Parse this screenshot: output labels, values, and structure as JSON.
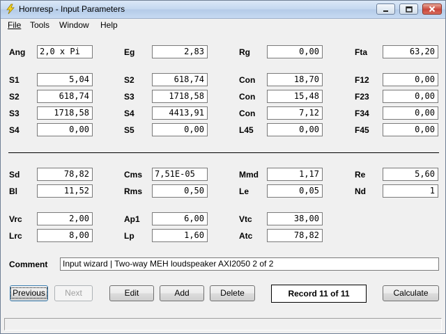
{
  "window": {
    "title": "Hornresp - Input Parameters"
  },
  "menu": {
    "file": "File",
    "tools": "Tools",
    "window": "Window",
    "help": "Help"
  },
  "params": {
    "ang": {
      "label": "Ang",
      "value": "2,0 x Pi"
    },
    "eg": {
      "label": "Eg",
      "value": "2,83"
    },
    "rg": {
      "label": "Rg",
      "value": "0,00"
    },
    "fta": {
      "label": "Fta",
      "value": "63,20"
    },
    "s1": {
      "label": "S1",
      "value": "5,04"
    },
    "s2a": {
      "label": "S2",
      "value": "618,74"
    },
    "con1": {
      "label": "Con",
      "value": "18,70"
    },
    "f12": {
      "label": "F12",
      "value": "0,00"
    },
    "s2b": {
      "label": "S2",
      "value": "618,74"
    },
    "s3a": {
      "label": "S3",
      "value": "1718,58"
    },
    "con2": {
      "label": "Con",
      "value": "15,48"
    },
    "f23": {
      "label": "F23",
      "value": "0,00"
    },
    "s3b": {
      "label": "S3",
      "value": "1718,58"
    },
    "s4a": {
      "label": "S4",
      "value": "4413,91"
    },
    "con3": {
      "label": "Con",
      "value": "7,12"
    },
    "f34": {
      "label": "F34",
      "value": "0,00"
    },
    "s4b": {
      "label": "S4",
      "value": "0,00"
    },
    "s5": {
      "label": "S5",
      "value": "0,00"
    },
    "l45": {
      "label": "L45",
      "value": "0,00"
    },
    "f45": {
      "label": "F45",
      "value": "0,00"
    },
    "sd": {
      "label": "Sd",
      "value": "78,82"
    },
    "cms": {
      "label": "Cms",
      "value": "7,51E-05"
    },
    "mmd": {
      "label": "Mmd",
      "value": "1,17"
    },
    "re": {
      "label": "Re",
      "value": "5,60"
    },
    "bl": {
      "label": "Bl",
      "value": "11,52"
    },
    "rms": {
      "label": "Rms",
      "value": "0,50"
    },
    "le": {
      "label": "Le",
      "value": "0,05"
    },
    "nd": {
      "label": "Nd",
      "value": "1"
    },
    "vrc": {
      "label": "Vrc",
      "value": "2,00"
    },
    "ap1": {
      "label": "Ap1",
      "value": "6,00"
    },
    "vtc": {
      "label": "Vtc",
      "value": "38,00"
    },
    "lrc": {
      "label": "Lrc",
      "value": "8,00"
    },
    "lp": {
      "label": "Lp",
      "value": "1,60"
    },
    "atc": {
      "label": "Atc",
      "value": "78,82"
    }
  },
  "comment": {
    "label": "Comment",
    "value": "Input wizard | Two-way MEH loudspeaker AXI2050 2 of 2"
  },
  "buttons": {
    "previous": "Previous",
    "next": "Next",
    "edit": "Edit",
    "add": "Add",
    "delete": "Delete",
    "calculate": "Calculate"
  },
  "record": "Record 11 of 11",
  "status": ""
}
